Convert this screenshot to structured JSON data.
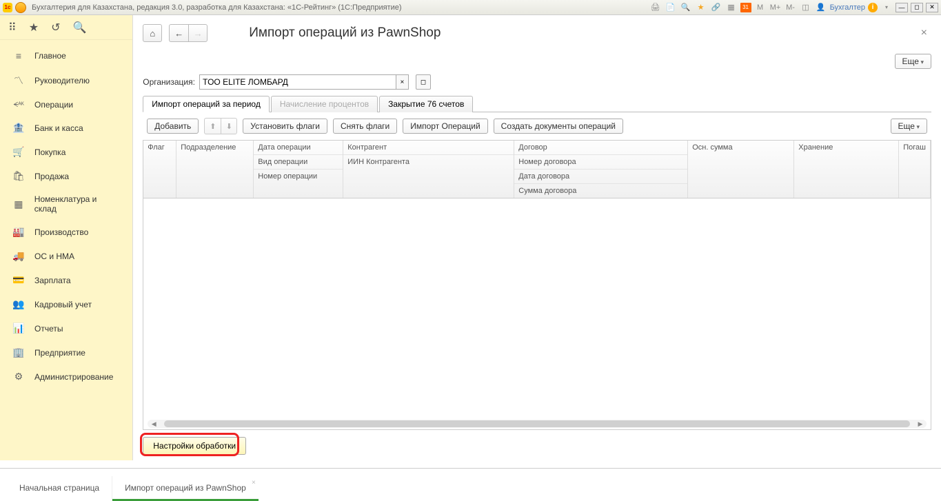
{
  "titlebar": {
    "text": "Бухгалтерия для Казахстана, редакция 3.0, разработка для Казахстана: «1С-Рейтинг»  (1С:Предприятие)",
    "user": "Бухгалтер",
    "m_labels": [
      "M",
      "M+",
      "M-"
    ],
    "cal": "31"
  },
  "sidebar": {
    "items": [
      {
        "icon": "≡",
        "label": "Главное"
      },
      {
        "icon": "〽",
        "label": "Руководителю"
      },
      {
        "icon": "ᗕᴬᴷ",
        "label": "Операции"
      },
      {
        "icon": "🏦",
        "label": "Банк и касса"
      },
      {
        "icon": "🛒",
        "label": "Покупка"
      },
      {
        "icon": "🛍",
        "label": "Продажа"
      },
      {
        "icon": "▦",
        "label": "Номенклатура и склад"
      },
      {
        "icon": "🏭",
        "label": "Производство"
      },
      {
        "icon": "🚚",
        "label": "ОС и НМА"
      },
      {
        "icon": "💳",
        "label": "Зарплата"
      },
      {
        "icon": "👥",
        "label": "Кадровый учет"
      },
      {
        "icon": "📊",
        "label": "Отчеты"
      },
      {
        "icon": "🏢",
        "label": "Предприятие"
      },
      {
        "icon": "⚙",
        "label": "Администрирование"
      }
    ]
  },
  "page": {
    "title": "Импорт операций из PawnShop",
    "more": "Еще"
  },
  "org": {
    "label": "Организация:",
    "value": "TOO ELITE ЛОМБАРД"
  },
  "tabs": [
    {
      "label": "Импорт операций за период",
      "active": true
    },
    {
      "label": "Начисление процентов",
      "disabled": true
    },
    {
      "label": "Закрытие 76 счетов"
    }
  ],
  "toolbar": {
    "add": "Добавить",
    "setFlags": "Установить флаги",
    "unsetFlags": "Снять флаги",
    "import": "Импорт Операций",
    "createDocs": "Создать документы операций",
    "more": "Еще"
  },
  "table": {
    "cols": {
      "flag": "Флаг",
      "podr": "Подразделение",
      "date": [
        "Дата операции",
        "Вид операции",
        "Номер операции"
      ],
      "kontr": [
        "Контрагент",
        "ИИН Контрагента"
      ],
      "dog": [
        "Договор",
        "Номер договора",
        "Дата договора",
        "Сумма договора"
      ],
      "summ": "Осн. сумма",
      "hran": "Хранение",
      "last": "Погаш"
    }
  },
  "settings_btn": "Настройки обработки",
  "bottom_tabs": {
    "start": "Начальная страница",
    "current": "Импорт операций из PawnShop"
  }
}
